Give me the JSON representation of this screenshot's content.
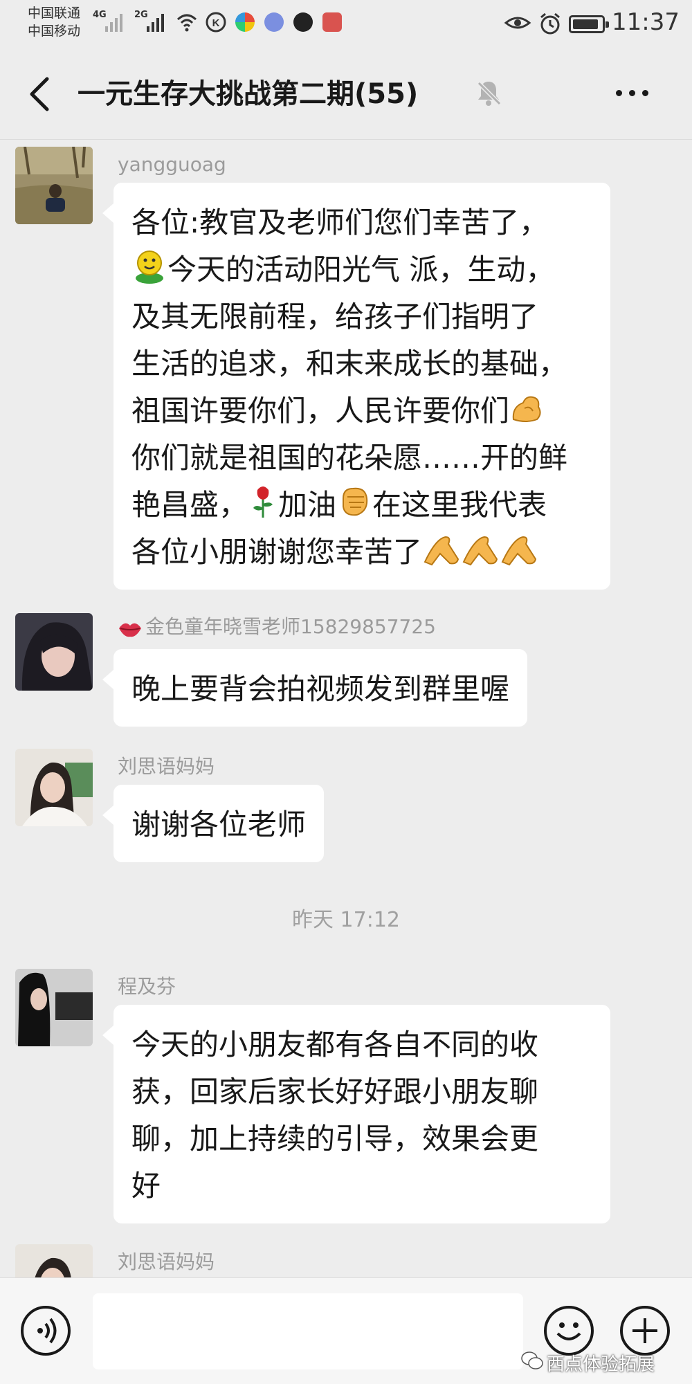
{
  "status_bar": {
    "carrier_1": "中国联通",
    "carrier_2": "中国移动",
    "net_1": "4G",
    "net_2": "2G",
    "time": "11:37"
  },
  "header": {
    "title": "一元生存大挑战第二期(55)"
  },
  "messages": [
    {
      "sender": "yangguoag",
      "lines": [
        "各位:教官及老师们您们幸苦了，",
        "今天的活动阳光气 派，生动，",
        "及其无限前程，给孩子们指明了",
        "生活的追求，和末来成长的基础，",
        "祖国许要你们，人民许要你们",
        "你们就是祖国的花朵愿……开的鲜",
        "艳昌盛，",
        "加油",
        "在这里我代表",
        "各位小朋谢谢您幸苦了"
      ]
    },
    {
      "sender": "金色童年晓雪老师15829857725",
      "text": "晚上要背会拍视频发到群里喔"
    },
    {
      "sender": "刘思语妈妈",
      "text": "谢谢各位老师"
    },
    {
      "sender": "程及芬",
      "lines": [
        "今天的小朋友都有各自不同的收",
        "获，回家后家长好好跟小朋友聊",
        "聊，加上持续的引导，效果会更",
        "好"
      ]
    },
    {
      "sender": "刘思语妈妈"
    }
  ],
  "timestamp": "昨天 17:12",
  "input_bar": {
    "watermark": "西点体验拓展"
  },
  "colors": {
    "background": "#ededed",
    "bubble": "#ffffff",
    "name_text": "#9b9b9b"
  }
}
